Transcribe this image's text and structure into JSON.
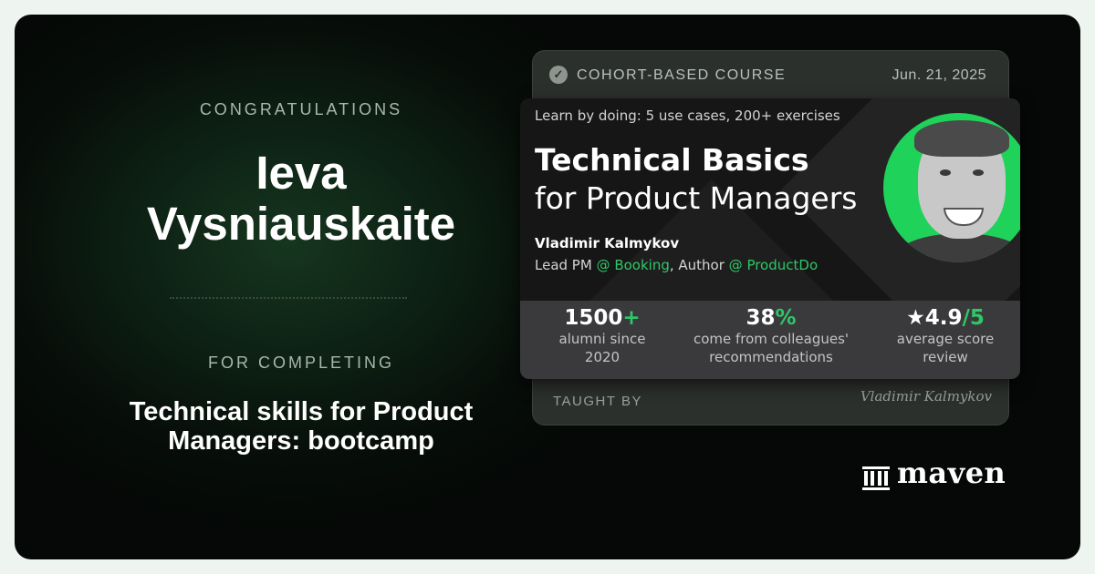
{
  "certificate": {
    "congrats_label": "CONGRATULATIONS",
    "recipient_first": "Ieva",
    "recipient_last": "Vysniauskaite",
    "for_completing_label": "FOR COMPLETING",
    "course_name_line1": "Technical skills for Product",
    "course_name_line2": "Managers: bootcamp"
  },
  "course_card": {
    "check_icon": "✓",
    "badge_label": "COHORT-BASED COURSE",
    "date": "Jun. 21, 2025",
    "tagline": "Learn by doing: 5 use cases, 200+ exercises",
    "title_line1": "Technical Basics",
    "title_line2": "for Product Managers",
    "author_name": "Vladimir Kalmykov",
    "role_prefix": "Lead PM ",
    "role_company1": "@ Booking",
    "role_mid": ", Author ",
    "role_company2": "@ ProductDo",
    "stats": [
      {
        "value": "1500",
        "accent": "+",
        "line1": "alumni since",
        "line2": "2020"
      },
      {
        "value": "38",
        "accent": "%",
        "line1": "come from colleagues'",
        "line2": "recommendations"
      },
      {
        "value": "★4.9",
        "accent": "/5",
        "line1": "average score",
        "line2": "review"
      }
    ],
    "taught_by_label": "TAUGHT BY",
    "signature": "Vladimir Kalmykov"
  },
  "brand": {
    "logo_icon": "columns-icon",
    "name": "maven"
  },
  "colors": {
    "accent_green": "#2ec866",
    "avatar_green": "#1fd35a",
    "background": "#070d09"
  }
}
